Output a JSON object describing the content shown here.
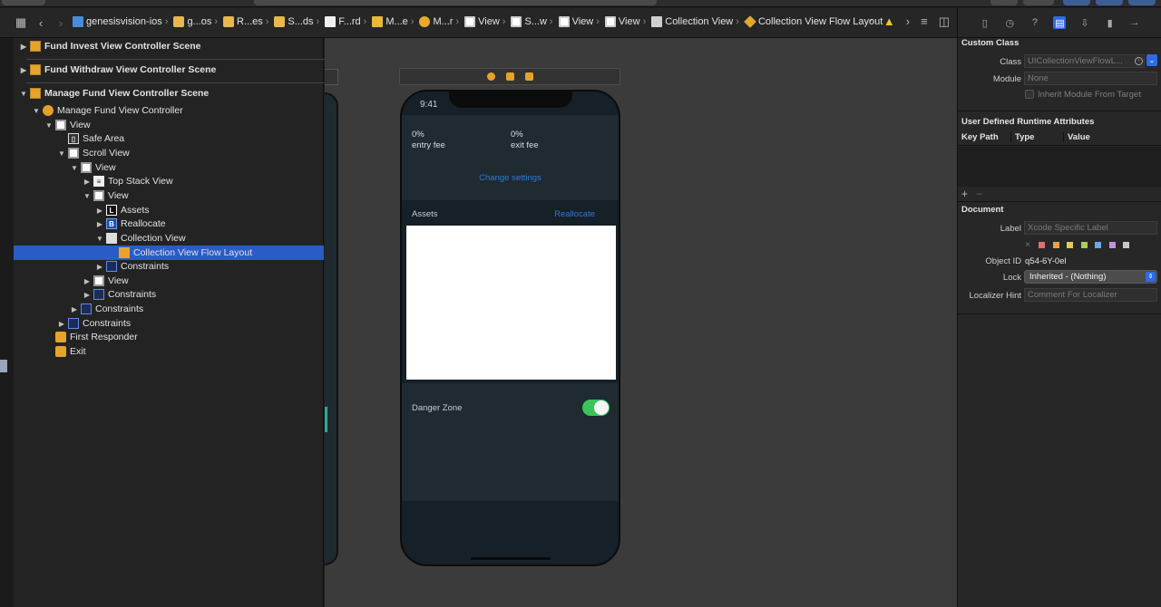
{
  "jumpbar": {
    "crumbs": [
      {
        "label": "genesisvision-ios",
        "icon": "project-icon"
      },
      {
        "label": "g...os",
        "icon": "folder-icon"
      },
      {
        "label": "R...es",
        "icon": "folder-icon"
      },
      {
        "label": "S...ds",
        "icon": "folder-icon"
      },
      {
        "label": "F...rd",
        "icon": "file-icon"
      },
      {
        "label": "M...e",
        "icon": "storyboard-icon"
      },
      {
        "label": "M...r",
        "icon": "view-controller-icon"
      },
      {
        "label": "View",
        "icon": "view-icon"
      },
      {
        "label": "S...w",
        "icon": "view-icon"
      },
      {
        "label": "View",
        "icon": "view-icon"
      },
      {
        "label": "View",
        "icon": "view-icon"
      },
      {
        "label": "Collection View",
        "icon": "collection-view-icon"
      },
      {
        "label": "Collection View Flow Layout",
        "icon": "flow-layout-icon"
      }
    ]
  },
  "outline": {
    "rows": [
      {
        "label": "Fund Invest View Controller Scene",
        "indent": 0,
        "disc": "▶",
        "icon": "scene",
        "scene": true
      },
      {
        "label": "Fund Withdraw View Controller Scene",
        "indent": 0,
        "disc": "▶",
        "icon": "scene",
        "scene": true
      },
      {
        "label": "Manage Fund View Controller Scene",
        "indent": 0,
        "disc": "▼",
        "icon": "scene",
        "scene": true
      },
      {
        "label": "Manage Fund View Controller",
        "indent": 1,
        "disc": "▼",
        "icon": "vc"
      },
      {
        "label": "View",
        "indent": 2,
        "disc": "▼",
        "icon": "view"
      },
      {
        "label": "Safe Area",
        "indent": 3,
        "disc": "",
        "icon": "safe"
      },
      {
        "label": "Scroll View",
        "indent": 3,
        "disc": "▼",
        "icon": "view"
      },
      {
        "label": "View",
        "indent": 4,
        "disc": "▼",
        "icon": "view"
      },
      {
        "label": "Top Stack View",
        "indent": 5,
        "disc": "▶",
        "icon": "stack"
      },
      {
        "label": "View",
        "indent": 5,
        "disc": "▼",
        "icon": "view"
      },
      {
        "label": "Assets",
        "indent": 6,
        "disc": "▶",
        "icon": "label"
      },
      {
        "label": "Reallocate",
        "indent": 6,
        "disc": "▶",
        "icon": "btn"
      },
      {
        "label": "Collection View",
        "indent": 6,
        "disc": "▼",
        "icon": "grid"
      },
      {
        "label": "Collection View Flow Layout",
        "indent": 7,
        "disc": "",
        "icon": "cube",
        "selected": true
      },
      {
        "label": "Constraints",
        "indent": 6,
        "disc": "▶",
        "icon": "cons"
      },
      {
        "label": "View",
        "indent": 5,
        "disc": "▶",
        "icon": "view"
      },
      {
        "label": "Constraints",
        "indent": 5,
        "disc": "▶",
        "icon": "cons"
      },
      {
        "label": "Constraints",
        "indent": 4,
        "disc": "▶",
        "icon": "cons"
      },
      {
        "label": "Constraints",
        "indent": 3,
        "disc": "▶",
        "icon": "cons"
      },
      {
        "label": "First Responder",
        "indent": 2,
        "disc": "",
        "icon": "resp"
      },
      {
        "label": "Exit",
        "indent": 2,
        "disc": "",
        "icon": "exit"
      }
    ]
  },
  "phone": {
    "status_time": "9:41",
    "entry_fee_value": "0%",
    "entry_fee_label": "entry fee",
    "exit_fee_value": "0%",
    "exit_fee_label": "exit fee",
    "change_settings": "Change settings",
    "assets_label": "Assets",
    "reallocate_label": "Reallocate",
    "danger_zone_label": "Danger Zone",
    "danger_toggle_on": true
  },
  "inspector": {
    "custom_class": {
      "title": "Custom Class",
      "class_label": "Class",
      "class_placeholder": "UICollectionViewFlowL...",
      "module_label": "Module",
      "module_placeholder": "None",
      "inherit_label": "Inherit Module From Target"
    },
    "runtime_attrs": {
      "title": "User Defined Runtime Attributes",
      "col_key_path": "Key Path",
      "col_type": "Type",
      "col_value": "Value",
      "add": "+",
      "remove": "−"
    },
    "document": {
      "title": "Document",
      "label_label": "Label",
      "label_placeholder": "Xcode Specific Label",
      "object_id_label": "Object ID",
      "object_id_value": "q54-6Y-0el",
      "lock_label": "Lock",
      "lock_value": "Inherited - (Nothing)",
      "localizer_label": "Localizer Hint",
      "localizer_placeholder": "Comment For Localizer",
      "swatch_clear": "×",
      "swatch_colors": [
        "#e26d6d",
        "#e6a14a",
        "#e0cc54",
        "#a9cf55",
        "#6aa8e8",
        "#c88ee0",
        "#c8c8c8"
      ]
    }
  },
  "colors": {
    "selection": "#2a5cc7",
    "accent_link": "#2d79d9",
    "toggle_on": "#3cc35a",
    "inspector_active": "#2e6be6"
  }
}
